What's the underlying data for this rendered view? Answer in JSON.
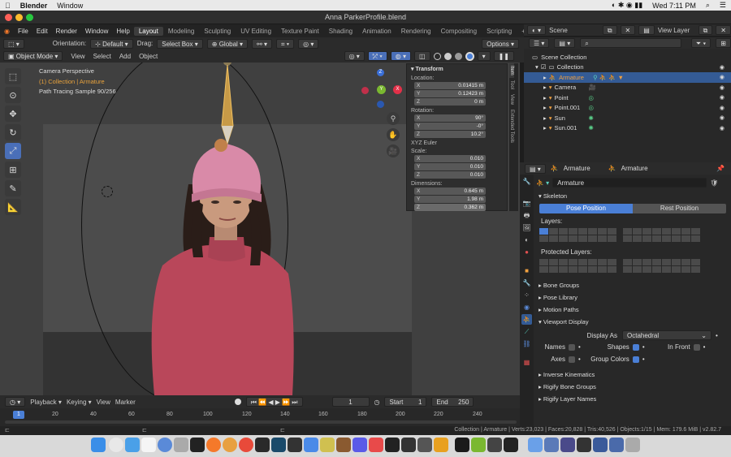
{
  "mac": {
    "app": "Blender",
    "menu": [
      "Window"
    ],
    "clock": "Wed 7:11 PM"
  },
  "window_title": "Anna ParkerProfile.blend",
  "menubar": {
    "items": [
      "File",
      "Edit",
      "Render",
      "Window",
      "Help"
    ],
    "tabs": [
      "Layout",
      "Modeling",
      "Sculpting",
      "UV Editing",
      "Texture Paint",
      "Shading",
      "Animation",
      "Rendering",
      "Compositing",
      "Scripting"
    ],
    "active_tab": "Layout",
    "scene": "Scene",
    "view_layer": "View Layer"
  },
  "header1": {
    "orientation_label": "Orientation:",
    "orientation_value": "Default",
    "drag_label": "Drag:",
    "drag_value": "Select Box",
    "transform_value": "Global",
    "options_label": "Options"
  },
  "header2": {
    "mode": "Object Mode",
    "menus": [
      "View",
      "Select",
      "Add",
      "Object"
    ]
  },
  "viewport": {
    "line1": "Camera Perspective",
    "line2": "(1) Collection | Armature",
    "line3": "Path Tracing Sample 90/256"
  },
  "npanel": {
    "title": "Transform",
    "location_label": "Location:",
    "location": [
      {
        "k": "X",
        "v": "0.01415 m"
      },
      {
        "k": "Y",
        "v": "0.12423 m"
      },
      {
        "k": "Z",
        "v": "0 m"
      }
    ],
    "rotation_label": "Rotation:",
    "rotation": [
      {
        "k": "X",
        "v": "90°"
      },
      {
        "k": "Y",
        "v": "-0°"
      },
      {
        "k": "Z",
        "v": "10.2°"
      }
    ],
    "rotation_mode": "XYZ Euler",
    "scale_label": "Scale:",
    "scale": [
      {
        "k": "X",
        "v": "0.010"
      },
      {
        "k": "Y",
        "v": "0.010"
      },
      {
        "k": "Z",
        "v": "0.010"
      }
    ],
    "dimensions_label": "Dimensions:",
    "dimensions": [
      {
        "k": "X",
        "v": "0.645 m"
      },
      {
        "k": "Y",
        "v": "1.98 m"
      },
      {
        "k": "Z",
        "v": "0.362 m"
      }
    ],
    "tabs": [
      "Item",
      "Tool",
      "View",
      "Extended Tools"
    ]
  },
  "timeline": {
    "menus": [
      "Playback",
      "Keying",
      "View",
      "Marker"
    ],
    "current_frame": "1",
    "start_label": "Start",
    "start": "1",
    "end_label": "End",
    "end": "250",
    "ticks": [
      "1",
      "20",
      "40",
      "60",
      "80",
      "100",
      "120",
      "140",
      "160",
      "180",
      "200",
      "220",
      "240"
    ]
  },
  "status": "Collection | Armature | Verts:23,023 | Faces:20,828 | Tris:40,526 | Objects:1/15 | Mem: 179.6 MiB | v2.82.7",
  "outliner": {
    "scene_collection": "Scene Collection",
    "collection": "Collection",
    "items": [
      {
        "name": "Armature",
        "selected": true
      },
      {
        "name": "Camera",
        "selected": false
      },
      {
        "name": "Point",
        "selected": false
      },
      {
        "name": "Point.001",
        "selected": false
      },
      {
        "name": "Sun",
        "selected": false
      },
      {
        "name": "Sun.001",
        "selected": false
      }
    ]
  },
  "properties": {
    "breadcrumb_object": "Armature",
    "breadcrumb_data": "Armature",
    "data_name": "Armature",
    "skeleton_label": "Skeleton",
    "pose_position": "Pose Position",
    "rest_position": "Rest Position",
    "layers_label": "Layers:",
    "protected_layers_label": "Protected Layers:",
    "panels": [
      "Bone Groups",
      "Pose Library",
      "Motion Paths"
    ],
    "viewport_display": "Viewport Display",
    "display_as_label": "Display As",
    "display_as_value": "Octahedral",
    "names_label": "Names",
    "shapes_label": "Shapes",
    "in_front_label": "In Front",
    "axes_label": "Axes",
    "group_colors_label": "Group Colors",
    "bottom_panels": [
      "Inverse Kinematics",
      "Rigify Bone Groups",
      "Rigify Layer Names"
    ]
  },
  "colors": {
    "accent": "#4a7fd6",
    "selection": "#345b95",
    "sweater": "#c04b5e",
    "hat": "#d98aa8"
  }
}
